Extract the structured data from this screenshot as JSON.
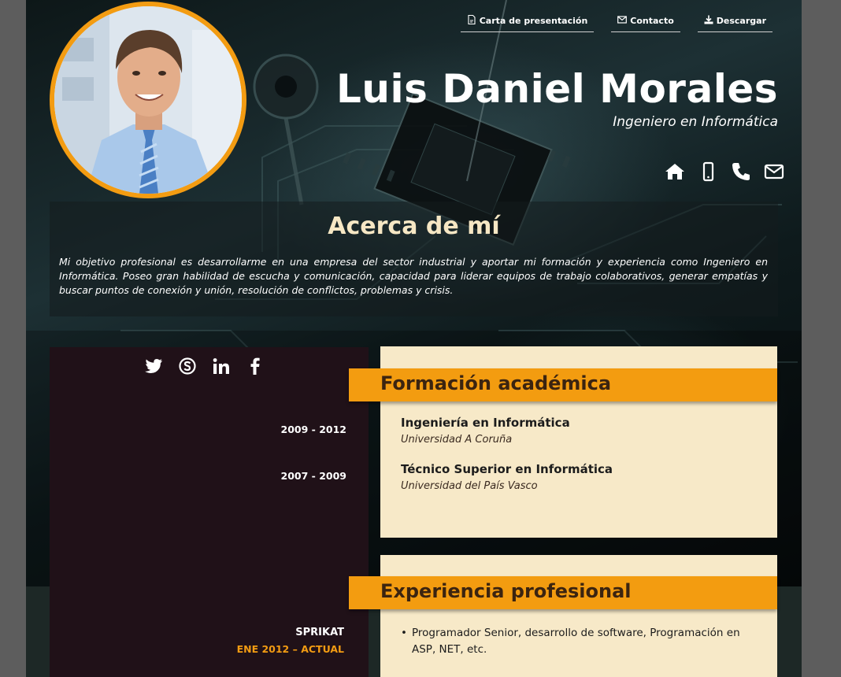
{
  "nav": {
    "cover_letter": "Carta de presentación",
    "contact": "Contacto",
    "download": "Descargar"
  },
  "header": {
    "name": "Luis Daniel Morales",
    "role": "Ingeniero en Informática",
    "contact_icons": [
      "home-icon",
      "mobile-icon",
      "phone-icon",
      "envelope-icon"
    ]
  },
  "about": {
    "title": "Acerca de mí",
    "text": "Mi objetivo profesional es desarrollarme en una empresa del sector industrial y aportar mi formación y experiencia como Ingeniero en Informática. Poseo gran habilidad de escucha y comunicación, capacidad para liderar equipos de trabajo colaborativos, generar empatías y buscar puntos de conexión y unión, resolución de conflictos, problemas y crisis."
  },
  "social": [
    "twitter-icon",
    "skype-icon",
    "linkedin-icon",
    "facebook-icon"
  ],
  "education": {
    "title": "Formación académica",
    "items": [
      {
        "date": "2009 - 2012",
        "degree": "Ingeniería en Informática",
        "school": "Universidad A Coruña"
      },
      {
        "date": "2007 - 2009",
        "degree": "Técnico Superior en Informática",
        "school": "Universidad del País Vasco"
      }
    ]
  },
  "experience": {
    "title": "Experiencia profesional",
    "items": [
      {
        "company": "SPRIKAT",
        "period": "ENE 2012 – ACTUAL",
        "description": "Programador Senior, desarrollo de software, Programación en ASP, NET, etc."
      }
    ]
  },
  "colors": {
    "accent": "#f39c12",
    "card": "#f7e9c8",
    "dark_column": "#201118",
    "page_background": "#5d5d5d"
  }
}
